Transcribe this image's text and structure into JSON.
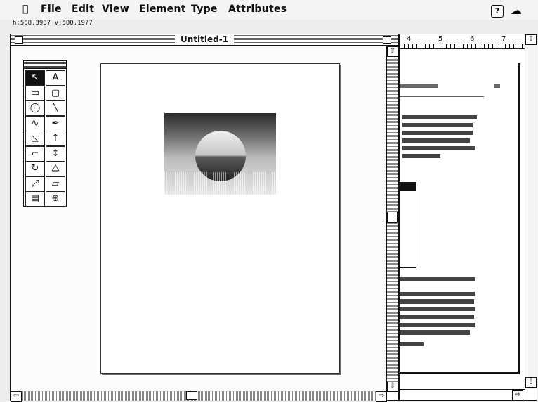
{
  "menubar": {
    "apple": "",
    "items": [
      "File",
      "Edit",
      "View",
      "Element",
      "Type",
      "Attributes"
    ],
    "help_icon": "?",
    "app_icon": "☁"
  },
  "coords": {
    "text": "h:568.3937   v:500.1977"
  },
  "window": {
    "title": "Untitled-1"
  },
  "ruler": {
    "labels": [
      "4",
      "5",
      "6",
      "7"
    ]
  },
  "tools": [
    {
      "name": "pointer-tool",
      "glyph": "↖"
    },
    {
      "name": "text-tool",
      "glyph": "A"
    },
    {
      "name": "rectangle-tool",
      "glyph": "▭"
    },
    {
      "name": "rounded-rectangle-tool",
      "glyph": "▢"
    },
    {
      "name": "oval-tool",
      "glyph": "◯"
    },
    {
      "name": "line-tool",
      "glyph": "╲"
    },
    {
      "name": "freehand-tool",
      "glyph": "∿"
    },
    {
      "name": "pen-tool",
      "glyph": "✒"
    },
    {
      "name": "knife-tool",
      "glyph": "◺"
    },
    {
      "name": "corner-point-tool",
      "glyph": "↑"
    },
    {
      "name": "connector-tool",
      "glyph": "⌐"
    },
    {
      "name": "curve-point-tool",
      "glyph": "↕"
    },
    {
      "name": "rotate-tool",
      "glyph": "↻"
    },
    {
      "name": "reflect-tool",
      "glyph": "⧋"
    },
    {
      "name": "scale-tool",
      "glyph": "⤢"
    },
    {
      "name": "skew-tool",
      "glyph": "▱"
    },
    {
      "name": "trace-tool",
      "glyph": "▤"
    },
    {
      "name": "zoom-tool",
      "glyph": "⊕"
    }
  ],
  "colors": {
    "ink": "#111111",
    "pattern_gray": "#888888"
  }
}
